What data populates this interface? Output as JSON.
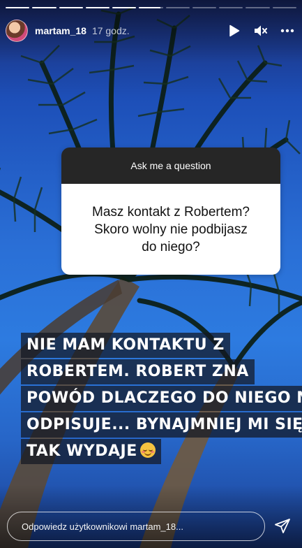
{
  "progress": {
    "segments": [
      1,
      1,
      1,
      1,
      1,
      0.9,
      0,
      0,
      0,
      0,
      0
    ]
  },
  "header": {
    "username": "martam_18",
    "time": "17 godz."
  },
  "icons": {
    "play": "play-icon",
    "mute": "speaker-muted-icon",
    "more": "more-horizontal-icon",
    "send": "paper-plane-icon"
  },
  "question": {
    "header": "Ask me a question",
    "lines": [
      "Masz kontakt z Robertem?",
      "Skoro wolny nie podbijasz",
      "do niego?"
    ]
  },
  "caption": {
    "lines": [
      "NIE MAM KONTAKTU Z",
      "ROBERTEM. ROBERT ZNA",
      "POWÓD DLACZEGO DO NIEGO NIE",
      "ODPISUJE... BYNAJMNIEJ MI SIĘ",
      "TAK WYDAJE"
    ],
    "emoji": "smiling-face-with-closed-eyes-emoji"
  },
  "reply": {
    "placeholder": "Odpowiedz użytkownikowi martam_18..."
  },
  "colors": {
    "sky": "#2a6fd6",
    "question_header_bg": "#262626",
    "question_body_bg": "#ffffff",
    "caption_bg": "#141822"
  }
}
